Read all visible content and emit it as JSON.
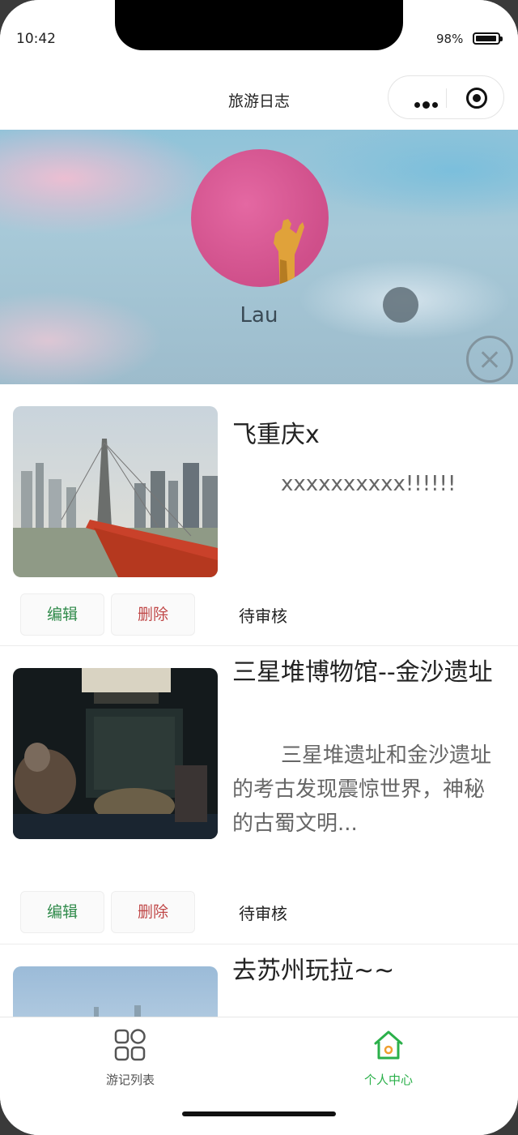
{
  "status_bar": {
    "time": "10:42",
    "battery": "98%"
  },
  "nav": {
    "title": "旅游日志"
  },
  "profile": {
    "username": "Lau"
  },
  "posts": [
    {
      "title": "飞重庆x",
      "desc": "xxxxxxxxxx!!!!!!",
      "edit": "编辑",
      "delete": "删除",
      "status": "待审核"
    },
    {
      "title": "三星堆博物馆--金沙遗址",
      "desc": "三星堆遗址和金沙遗址的考古发现震惊世界，神秘的古蜀文明...",
      "edit": "编辑",
      "delete": "删除",
      "status": "待审核"
    },
    {
      "title": "去苏州玩拉~~",
      "desc": ""
    }
  ],
  "tabbar": {
    "items": [
      {
        "label": "游记列表",
        "icon": "grid-icon",
        "active": false
      },
      {
        "label": "个人中心",
        "icon": "home-icon",
        "active": true
      }
    ],
    "active_color": "#2bb04a"
  }
}
